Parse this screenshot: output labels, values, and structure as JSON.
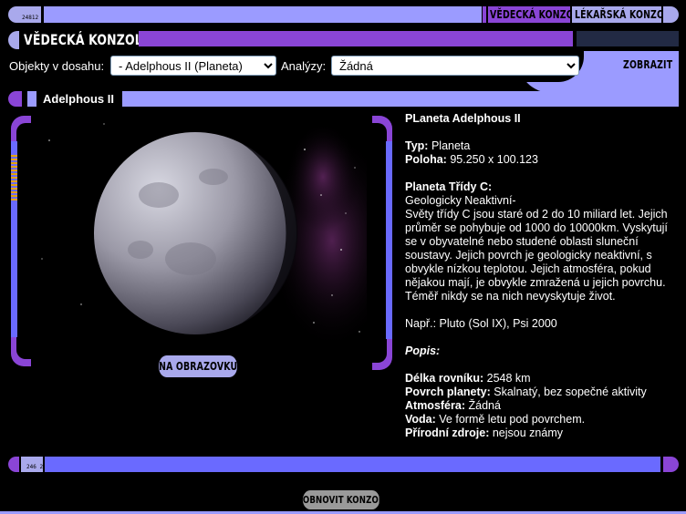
{
  "header": {
    "code": "24812",
    "tab_science": "VĚDECKÁ KONZOLE",
    "tab_medical": "LÉKAŘSKÁ KONZOLE",
    "console_title": "VĚDECKÁ KONZOLE"
  },
  "controls": {
    "objects_label": "Objekty v dosahu:",
    "objects_value": "- Adelphous II (Planeta)",
    "analysis_label": "Analýzy:",
    "analysis_value": "Žádná",
    "display_button": "ZOBRAZIT"
  },
  "object_title": "Adelphous II",
  "viewer": {
    "screen_button": "NA OBRAZOVKU"
  },
  "info": {
    "heading": "PLaneta Adelphous II",
    "type_label": "Typ:",
    "type_value": "Planeta",
    "position_label": "Poloha:",
    "position_value": "95.250 x 100.123",
    "class_heading": "Planeta Třídy C:",
    "class_sub": "Geologicky Neaktivní-",
    "class_description": "Světy třídy C jsou staré od 2 do 10 miliard let. Jejich průměr se pohybuje od 1000 do 10000km. Vyskytují se v obyvatelné nebo studené oblasti sluneční soustavy. Jejich povrch je geologicky neaktivní, s obvykle nízkou teplotou. Jejich atmosféra, pokud nějakou mají, je obvykle zmražená u jejich povrchu. Téměř nikdy se na nich nevyskytuje život.",
    "examples": "Např.: Pluto (Sol IX), Psi 2000",
    "description_label": "Popis:",
    "equator_label": "Délka rovníku:",
    "equator_value": "2548 km",
    "surface_label": "Povrch planety:",
    "surface_value": "Skalnatý, bez sopečné aktivity",
    "atmosphere_label": "Atmosféra:",
    "atmosphere_value": "Žádná",
    "water_label": "Voda:",
    "water_value": "Ve formě letu pod povrchem.",
    "resources_label": "Přírodní zdroje:",
    "resources_value": "nejsou známy"
  },
  "footer": {
    "code": "246 2",
    "reset_button": "OBNOVIT KONZOLI"
  },
  "colors": {
    "lavender": "#a9a9ec",
    "purple": "#8a45d6",
    "periwinkle": "#9b9bff",
    "blue": "#6a6aff"
  }
}
